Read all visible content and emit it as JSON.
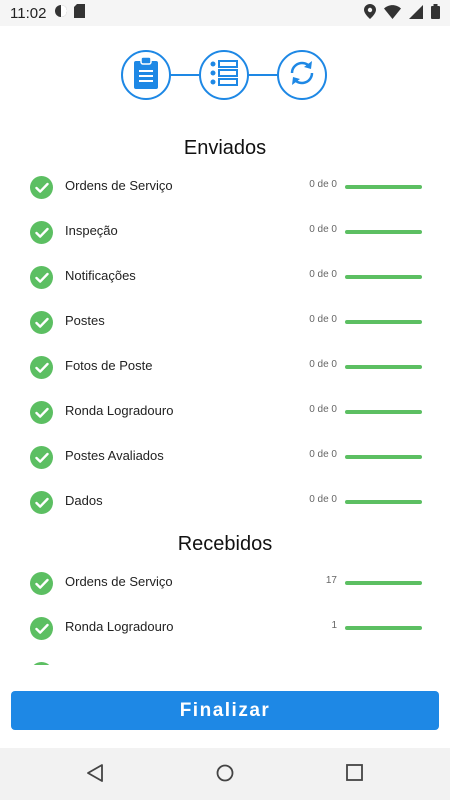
{
  "status_bar": {
    "time": "11:02",
    "icons": [
      "circle-status-icon",
      "sd-card-icon",
      "location-icon",
      "wifi-icon",
      "signal-icon",
      "battery-icon"
    ]
  },
  "stepper": {
    "steps": [
      "clipboard-icon",
      "list-icon",
      "sync-icon"
    ],
    "color": "#1e88e5"
  },
  "enviados": {
    "title": "Enviados",
    "items": [
      {
        "label": "Ordens de Serviço",
        "count": "0 de 0",
        "progress": 1.0
      },
      {
        "label": "Inspeção",
        "count": "0 de 0",
        "progress": 1.0
      },
      {
        "label": "Notificações",
        "count": "0 de 0",
        "progress": 1.0
      },
      {
        "label": "Postes",
        "count": "0 de 0",
        "progress": 1.0
      },
      {
        "label": "Fotos de Poste",
        "count": "0 de 0",
        "progress": 1.0
      },
      {
        "label": "Ronda Logradouro",
        "count": "0 de 0",
        "progress": 1.0
      },
      {
        "label": "Postes Avaliados",
        "count": "0 de 0",
        "progress": 1.0
      },
      {
        "label": "Dados",
        "count": "0 de 0",
        "progress": 1.0
      }
    ]
  },
  "recebidos": {
    "title": "Recebidos",
    "items": [
      {
        "label": "Ordens de Serviço",
        "count": "17",
        "progress": 1.0
      },
      {
        "label": "Ronda Logradouro",
        "count": "1",
        "progress": 1.0
      },
      {
        "label": "",
        "count": "",
        "progress": 1.0
      }
    ]
  },
  "footer": {
    "finalize_label": "Finalizar"
  },
  "colors": {
    "accent": "#1e88e5",
    "success": "#5cbf62"
  }
}
